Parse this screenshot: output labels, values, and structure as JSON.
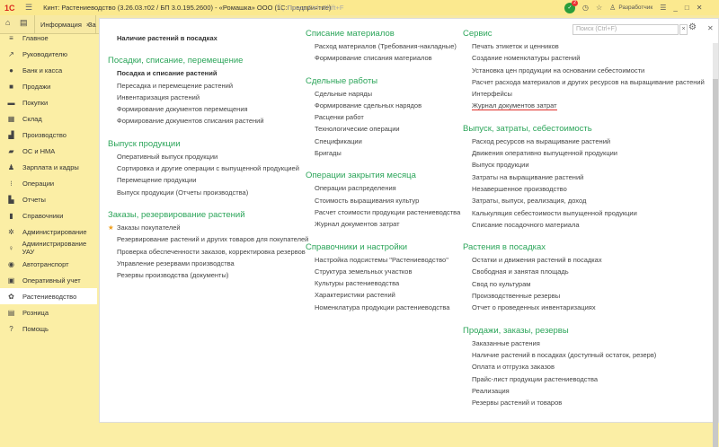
{
  "titlebar": {
    "logo": "1С",
    "title": "Кинт: Растениеводство (3.26.03.т02 / БП 3.0.195.2600) - «Ромашка» ООО  (1С:Предприятие)",
    "search_placeholder": "Поиск Ctrl+Shift+F",
    "notifications": "2",
    "user": "Разработчик"
  },
  "tabs": [
    {
      "label": "Информация"
    },
    {
      "label": "За"
    }
  ],
  "sidebar": {
    "items": [
      {
        "label": "Главное",
        "icon": "≡"
      },
      {
        "label": "Руководителю",
        "icon": "↗"
      },
      {
        "label": "Банк и касса",
        "icon": "●"
      },
      {
        "label": "Продажи",
        "icon": "■"
      },
      {
        "label": "Покупки",
        "icon": "▬"
      },
      {
        "label": "Склад",
        "icon": "▦"
      },
      {
        "label": "Производство",
        "icon": "▟"
      },
      {
        "label": "ОС и НМА",
        "icon": "▰"
      },
      {
        "label": "Зарплата и кадры",
        "icon": "♟"
      },
      {
        "label": "Операции",
        "icon": "⁝"
      },
      {
        "label": "Отчеты",
        "icon": "▙"
      },
      {
        "label": "Справочники",
        "icon": "▮"
      },
      {
        "label": "Администрирование",
        "icon": "✲"
      },
      {
        "label": "Администрирование УАУ",
        "icon": "♀"
      },
      {
        "label": "Автотранспорт",
        "icon": "◉"
      },
      {
        "label": "Оперативный учет",
        "icon": "▣"
      },
      {
        "label": "Растениеводство",
        "icon": "✿",
        "selected": true
      },
      {
        "label": "Розница",
        "icon": "▤"
      },
      {
        "label": "Помощь",
        "icon": "?"
      }
    ]
  },
  "panel": {
    "search_placeholder": "Поиск (Ctrl+F)"
  },
  "columns": [
    [
      {
        "items": [
          {
            "label": "Наличие растений в посадках",
            "bold": true
          }
        ]
      },
      {
        "heading": "Посадки, списание, перемещение",
        "items": [
          {
            "label": "Посадка и списание растений",
            "bold": true
          },
          {
            "label": "Пересадка и перемещение растений"
          },
          {
            "label": "Инвентаризация растений"
          },
          {
            "label": "Формирование документов перемещения"
          },
          {
            "label": "Формирование документов списания растений"
          }
        ]
      },
      {
        "heading": "Выпуск продукции",
        "items": [
          {
            "label": "Оперативный выпуск продукции"
          },
          {
            "label": "Сортировка и другие операции с выпущенной продукцией"
          },
          {
            "label": "Перемещение продукции"
          },
          {
            "label": "Выпуск продукции (Отчеты производства)"
          }
        ]
      },
      {
        "heading": "Заказы, резервирование растений",
        "items": [
          {
            "label": "Заказы покупателей",
            "star": true
          },
          {
            "label": "Резервирование растений и других товаров для покупателей"
          },
          {
            "label": "Проверка обеспеченности заказов, корректировка резервов"
          },
          {
            "label": "Управление резервами производства"
          },
          {
            "label": "Резервы производства (документы)"
          }
        ]
      }
    ],
    [
      {
        "heading": "Списание материалов",
        "items": [
          {
            "label": "Расход материалов (Требования-накладные)"
          },
          {
            "label": "Формирование списания материалов"
          }
        ]
      },
      {
        "heading": "Сдельные работы",
        "items": [
          {
            "label": "Сдельные наряды"
          },
          {
            "label": "Формирование сдельных нарядов"
          },
          {
            "label": "Расценки работ"
          },
          {
            "label": "Технологические операции"
          },
          {
            "label": "Спецификации"
          },
          {
            "label": "Бригады"
          }
        ]
      },
      {
        "heading": "Операции закрытия месяца",
        "items": [
          {
            "label": "Операции распределения"
          },
          {
            "label": "Стоимость выращивания культур"
          },
          {
            "label": "Расчет стоимости продукции растениеводства"
          },
          {
            "label": "Журнал документов затрат"
          }
        ]
      },
      {
        "heading": "Справочники и настройки",
        "items": [
          {
            "label": "Настройка подсистемы \"Растениеводство\""
          },
          {
            "label": "Структура земельных участков"
          },
          {
            "label": "Культуры растениеводства"
          },
          {
            "label": "Характеристики растений"
          },
          {
            "label": "Номенклатура продукции растениеводства"
          }
        ]
      }
    ],
    [
      {
        "heading": "Сервис",
        "items": [
          {
            "label": "Печать этикеток и ценников"
          },
          {
            "label": "Создание номенклатуры растений"
          },
          {
            "label": "Установка цен продукции на основании себестоимости"
          },
          {
            "label": "Расчет расхода материалов и других ресурсов на выращивание растений"
          },
          {
            "label": "Интерфейсы"
          },
          {
            "label": "Журнал документов затрат",
            "underlined": true
          }
        ]
      },
      {
        "heading": "Выпуск, затраты, себестоимость",
        "items": [
          {
            "label": "Расход ресурсов на выращивание растений"
          },
          {
            "label": "Движения оперативно выпущенной продукции"
          },
          {
            "label": "Выпуск продукции"
          },
          {
            "label": "Затраты на выращивание растений"
          },
          {
            "label": "Незавершенное производство"
          },
          {
            "label": "Затраты, выпуск, реализация, доход"
          },
          {
            "label": "Калькуляция себестоимости выпущенной продукции"
          },
          {
            "label": "Списание посадочного материала"
          }
        ]
      },
      {
        "heading": "Растения в посадках",
        "items": [
          {
            "label": "Остатки и движения растений в посадках"
          },
          {
            "label": "Свободная и занятая площадь"
          },
          {
            "label": "Свод по культурам"
          },
          {
            "label": "Производственные резервы"
          },
          {
            "label": "Отчет о проведенных инвентаризациях"
          }
        ]
      },
      {
        "heading": "Продажи, заказы, резервы",
        "items": [
          {
            "label": "Заказанные растения"
          },
          {
            "label": "Наличие растений в посадках (доступный остаток, резерв)"
          },
          {
            "label": "Оплата и отгрузка заказов"
          },
          {
            "label": "Прайс-лист продукции растениеводства"
          },
          {
            "label": "Реализация"
          },
          {
            "label": "Резервы растений и товаров"
          }
        ]
      }
    ]
  ],
  "colors": {
    "accent_heading": "#2ca55a",
    "underline": "#e0302a",
    "titlebar": "#fbe98f",
    "sidebar": "#fbeea5"
  }
}
